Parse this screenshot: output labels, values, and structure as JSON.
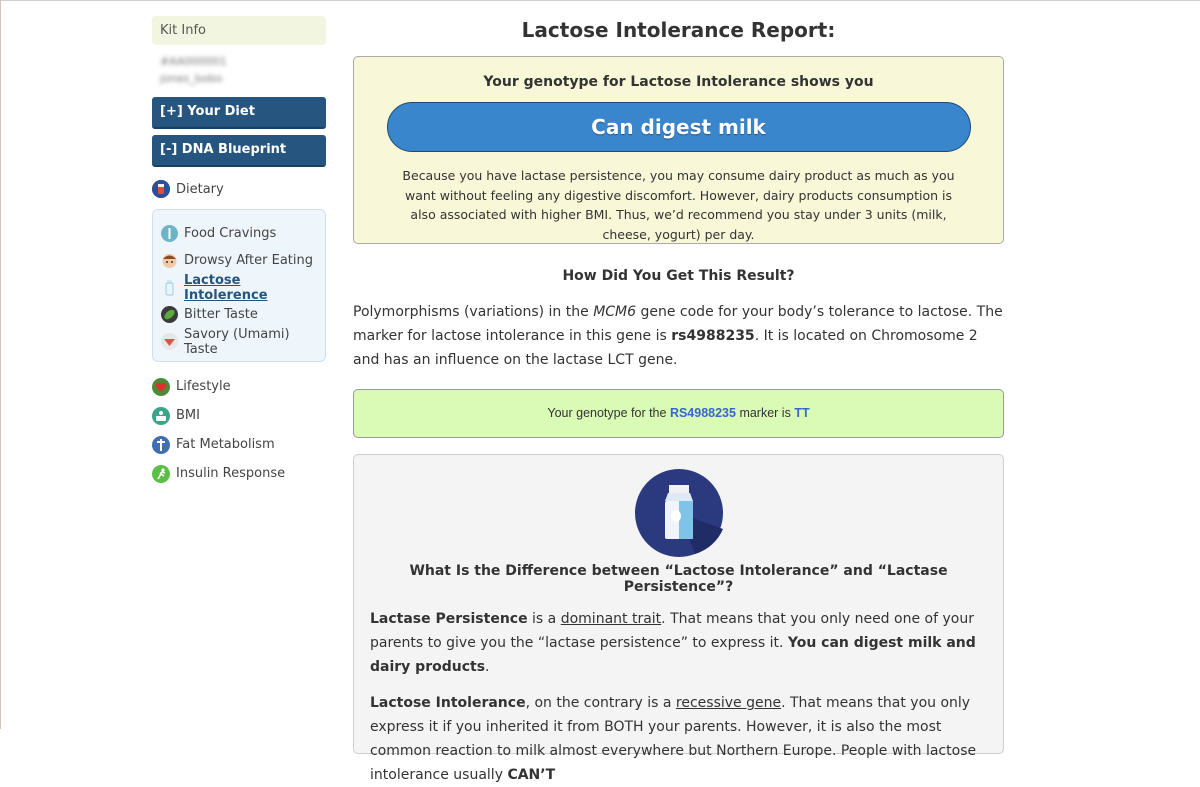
{
  "sidebar": {
    "kit_info": "Kit Info",
    "kit_id": "#AA000001",
    "kit_user": "jones_bobo",
    "nav_diet": "[+] Your Diet",
    "nav_dna": "[-] DNA Blueprint",
    "dietary": "Dietary",
    "sub_items": {
      "food_cravings": "Food Cravings",
      "drowsy": "Drowsy After Eating",
      "lactose": "Lactose Intolerence",
      "bitter": "Bitter Taste",
      "savory": "Savory (Umami) Taste"
    },
    "lifestyle": "Lifestyle",
    "bmi": "BMI",
    "fat": "Fat Metabolism",
    "insulin": "Insulin Response"
  },
  "report": {
    "title": "Lactose Intolerance Report:",
    "genotype_heading": "Your genotype for Lactose Intolerance shows you",
    "result": "Can digest milk",
    "description": "Because you have lactase persistence, you may consume dairy product as much as you want without feeling any digestive discomfort. However, dairy products consumption is also associated with higher BMI. Thus, we’d recommend you stay under 3 units (milk, cheese, yogurt) per day."
  },
  "how": {
    "heading": "How Did You Get This Result?",
    "p1_a": "Polymorphisms (variations) in the ",
    "gene": "MCM6",
    "p1_b": " gene code for your body’s tolerance to lactose. The marker for lactose intolerance in this gene is ",
    "marker": "rs4988235",
    "p1_c": ". It is located on Chromosome 2 and has an influence on the lactase LCT gene."
  },
  "genotype_box": {
    "prefix": "Your genotype for the ",
    "marker": "RS4988235",
    "middle": " marker is ",
    "genotype": "TT"
  },
  "difference": {
    "heading": "What Is the Difference between “Lactose Intolerance” and “Lactase Persistence”?",
    "p1_term": "Lactase Persistence",
    "p1_a": " is a ",
    "p1_link": "dominant trait",
    "p1_b": ". That means that you only need one of your parents to give you the “lactase persistence” to express it. ",
    "p1_bold": "You can digest milk and dairy products",
    "p1_end": ".",
    "p2_term": "Lactose Intolerance",
    "p2_a": ", on the contrary is a ",
    "p2_link": "recessive gene",
    "p2_b": ". That means that you only express it if you inherited it from BOTH your parents. However, it is also the most common reaction to milk almost everywhere but Northern Europe. People with lactose intolerance usually ",
    "p2_bold": "CAN’T"
  },
  "colors": {
    "nav_blue": "#26557f",
    "pill_blue": "#3a86cd",
    "result_bg": "#f8f7d7",
    "genotype_bg": "#d9fbb6",
    "marker_blue": "#3867c8"
  }
}
